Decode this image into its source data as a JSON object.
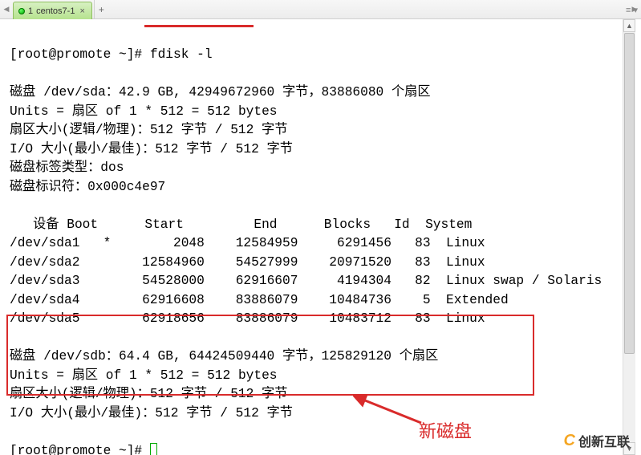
{
  "tabbar": {
    "tab_index": "1",
    "tab_title": "centos7-1",
    "close_glyph": "×",
    "add_glyph": "+",
    "nav_left": "◀",
    "nav_right": "▶",
    "menu_glyph": "≡ ▾"
  },
  "term": {
    "prompt_line": "[root@promote ~]# fdisk -l",
    "sda_l1": "磁盘 /dev/sda：42.9 GB, 42949672960 字节，83886080 个扇区",
    "sda_l2": "Units = 扇区 of 1 * 512 = 512 bytes",
    "sda_l3": "扇区大小(逻辑/物理)：512 字节 / 512 字节",
    "sda_l4": "I/O 大小(最小/最佳)：512 字节 / 512 字节",
    "sda_l5": "磁盘标签类型：dos",
    "sda_l6": "磁盘标识符：0x000c4e97",
    "hdr": "   设备 Boot      Start         End      Blocks   Id  System",
    "r1": "/dev/sda1   *        2048    12584959     6291456   83  Linux",
    "r2": "/dev/sda2        12584960    54527999    20971520   83  Linux",
    "r3": "/dev/sda3        54528000    62916607     4194304   82  Linux swap / Solaris",
    "r4": "/dev/sda4        62916608    83886079    10484736    5  Extended",
    "r5": "/dev/sda5        62918656    83886079    10483712   83  Linux",
    "sdb_l1": "磁盘 /dev/sdb：64.4 GB, 64424509440 字节，125829120 个扇区",
    "sdb_l2": "Units = 扇区 of 1 * 512 = 512 bytes",
    "sdb_l3": "扇区大小(逻辑/物理)：512 字节 / 512 字节",
    "sdb_l4": "I/O 大小(最小/最佳)：512 字节 / 512 字节",
    "prompt2": "[root@promote ~]# "
  },
  "annotation": {
    "new_disk": "新磁盘"
  },
  "watermark": {
    "c": "C",
    "text": "创新互联"
  },
  "scroll": {
    "up": "▲",
    "down": "▼"
  }
}
